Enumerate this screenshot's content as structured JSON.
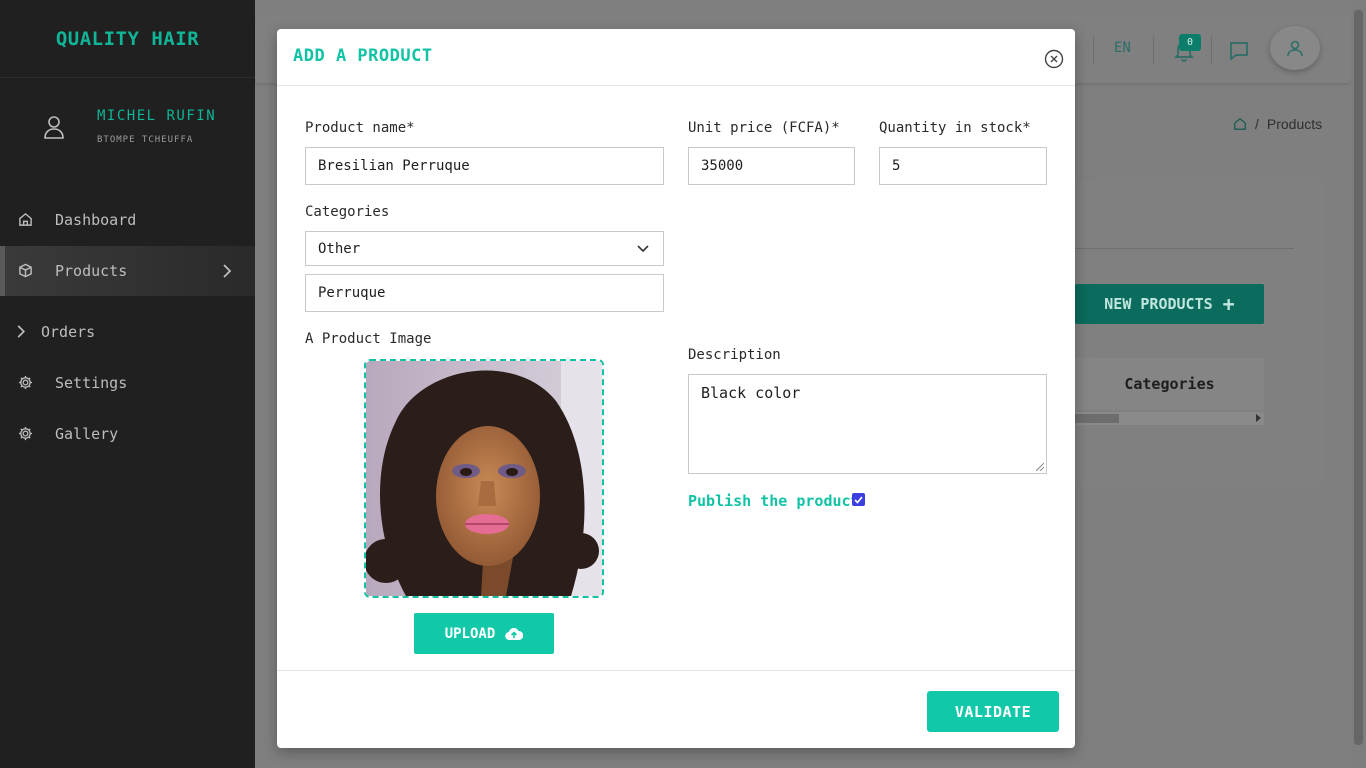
{
  "sidebar": {
    "brand": "QUALITY HAIR",
    "user_name": "MICHEL RUFIN",
    "user_sub": "BTOMPE TCHEUFFA",
    "items": [
      {
        "label": "Dashboard",
        "icon": "home-icon"
      },
      {
        "label": "Products",
        "icon": "box-icon",
        "active": true
      },
      {
        "label": "Orders",
        "icon": "chevron-right-icon"
      },
      {
        "label": "Settings",
        "icon": "gear-icon"
      },
      {
        "label": "Gallery",
        "icon": "gear-icon"
      }
    ]
  },
  "topbar": {
    "language": "EN",
    "notification_count": "0"
  },
  "breadcrumb": {
    "current": "Products"
  },
  "background": {
    "new_button": "NEW PRODUCTS",
    "table_header": "Categories"
  },
  "modal": {
    "title": "ADD A PRODUCT",
    "product_name_label": "Product name*",
    "product_name_value": "Bresilian Perruque",
    "unit_price_label": "Unit price (FCFA)*",
    "unit_price_value": "35000",
    "quantity_label": "Quantity in stock*",
    "quantity_value": "5",
    "categories_label": "Categories",
    "category_selected": "Other",
    "category_custom_value": "Perruque",
    "image_label": "A Product Image",
    "upload_label": "UPLOAD",
    "description_label": "Description",
    "description_value": "Black color",
    "publish_label": "Publish the product",
    "publish_checked": true,
    "validate_label": "VALIDATE"
  },
  "colors": {
    "accent": "#11c3a4",
    "sidebar_bg": "#202020",
    "checkbox": "#3b3fe0"
  }
}
